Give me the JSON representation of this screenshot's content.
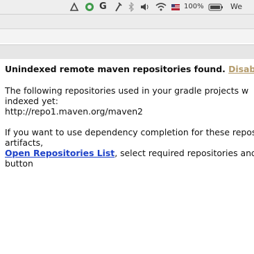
{
  "menubar": {
    "icons": [
      "drive-icon",
      "chat-icon",
      "g-icon",
      "wrench-icon",
      "bluetooth-icon",
      "volume-icon",
      "wifi-icon",
      "flag-icon",
      "battery-icon"
    ],
    "g_label": "G",
    "battery_percent": "100%",
    "clock_fragment": "We"
  },
  "notice": {
    "title": "Unindexed remote maven repositories found.",
    "disable_link": "Disable...",
    "line1": "The following repositories used in your gradle projects w",
    "line2": "indexed yet:",
    "repo_url": "http://repo1.maven.org/maven2",
    "line3": "If you want to use dependency completion for these repos",
    "line4": "artifacts,",
    "open_link": "Open Repositories List",
    "line5_rest": ", select required repositories and",
    "line6": "button"
  },
  "colors": {
    "link": "#1c41c8",
    "disable_link": "#b39a6a",
    "menubar_bg": "#eeeeee"
  }
}
